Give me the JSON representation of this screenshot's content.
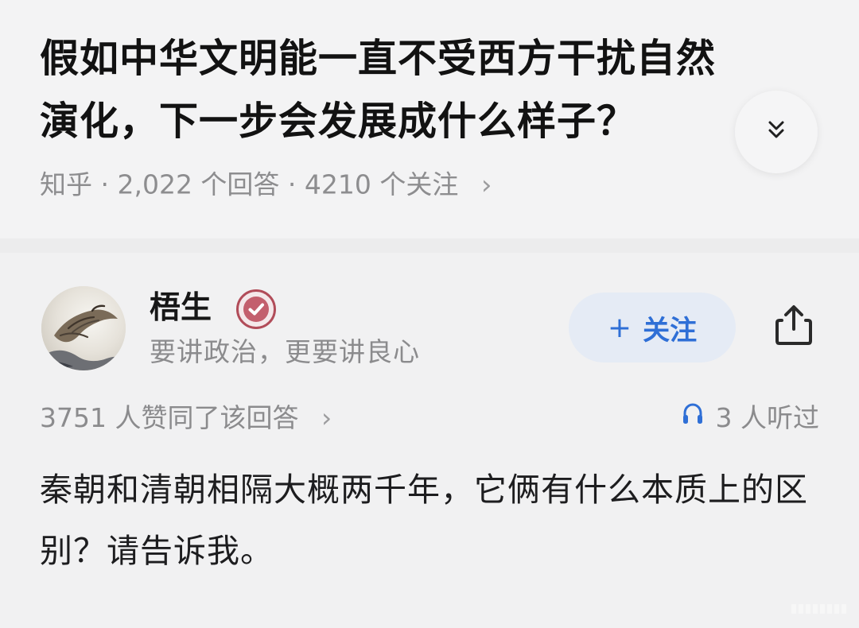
{
  "question": {
    "title": "假如中华文明能一直不受西方干扰自然演化，下一步会发展成什么样子？",
    "meta": "知乎 · 2,022 个回答 · 4210 个关注",
    "meta_arrow": "›"
  },
  "author": {
    "name": "梧生",
    "bio": "要讲政治，更要讲良心",
    "follow_label": "关注",
    "follow_prefix": "+"
  },
  "answer": {
    "upvotes_text": "3751 人赞同了该回答",
    "upvotes_arrow": "›",
    "listeners_text": "3 人听过",
    "content": "秦朝和清朝相隔大概两千年，它俩有什么本质上的区别？请告诉我。"
  },
  "icons": {
    "expand": "chevron-double-down-icon",
    "verified": "verified-badge-icon",
    "share": "share-icon",
    "listen": "headphones-icon"
  },
  "colors": {
    "accent": "#2f6fd6",
    "follow_bg": "#e5ebf5",
    "verified_red": "#b14c59",
    "muted_text": "#8b8b8d"
  }
}
